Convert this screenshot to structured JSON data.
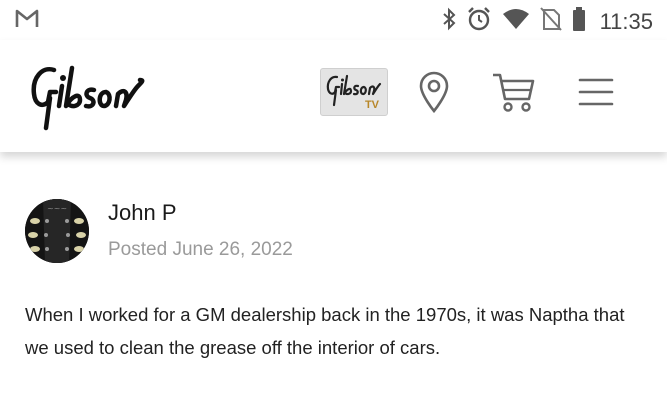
{
  "status_bar": {
    "time": "11:35",
    "icons": [
      "gmail-icon",
      "bluetooth-icon",
      "alarm-icon",
      "wifi-icon",
      "no-sim-icon",
      "battery-icon"
    ]
  },
  "header": {
    "logo_text": "Gibson",
    "tv_logo_text": "Gibson",
    "tv_badge": "TV",
    "icons": [
      "location-pin-icon",
      "cart-icon",
      "hamburger-menu-icon"
    ]
  },
  "post": {
    "author": "John P",
    "posted_prefix": "Posted",
    "posted_date": "June 26, 2022",
    "body": "When I worked for a GM dealership back in the 1970s, it was Naptha that we used to clean the grease off the interior of cars."
  },
  "colors": {
    "background": "#ffffff",
    "text": "#222222",
    "muted_text": "#9a9a9a",
    "icon_gray": "#666666",
    "tv_badge": "#b8872a"
  }
}
